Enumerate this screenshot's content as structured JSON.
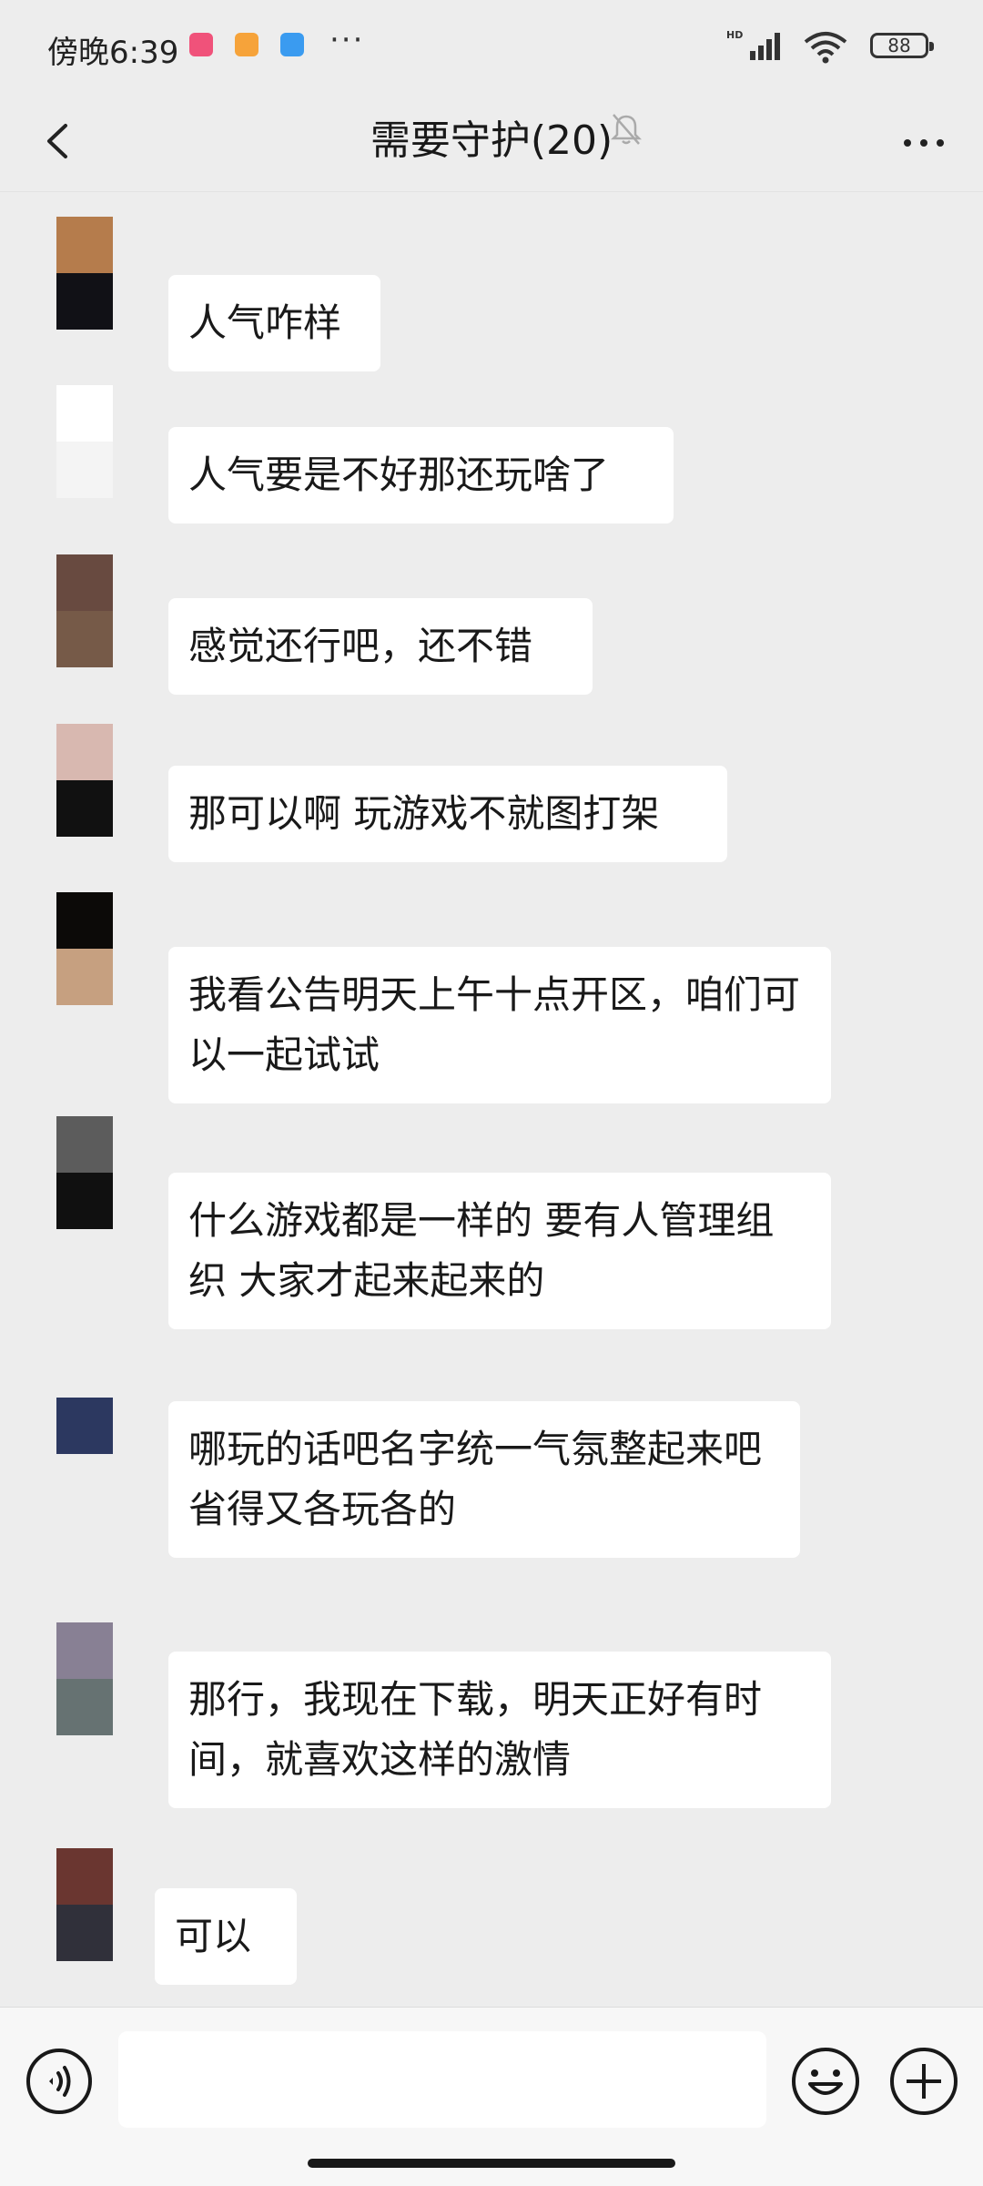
{
  "status_bar": {
    "time": "傍晚6:39",
    "more": "···",
    "network": "HD",
    "battery": "88"
  },
  "nav": {
    "title": "需要守护(20)"
  },
  "messages": [
    {
      "text": "人气咋样",
      "avatar_colors": [
        "#b57c4c",
        "#111116"
      ]
    },
    {
      "text": "人气要是不好那还玩啥了",
      "avatar_colors": [
        "#ffffff",
        "#f4f4f4"
      ]
    },
    {
      "text": "感觉还行吧，还不错",
      "avatar_colors": [
        "#684a40",
        "#765a48"
      ]
    },
    {
      "text": "那可以啊 玩游戏不就图打架",
      "avatar_colors": [
        "#d8b8b0",
        "#111111"
      ]
    },
    {
      "text": "我看公告明天上午十点开区，咱们可以一起试试",
      "avatar_colors": [
        "#0c0a08",
        "#c6a080"
      ]
    },
    {
      "text": "什么游戏都是一样的 要有人管理组织 大家才起来起来的",
      "avatar_colors": [
        "#5c5c5c",
        "#101010"
      ]
    },
    {
      "text": "哪玩的话吧名字统一气氛整起来吧 省得又各玩各的",
      "avatar_colors": [
        "#2c3860"
      ]
    },
    {
      "text": "那行，我现在下载，明天正好有时间，就喜欢这样的激情",
      "avatar_colors": [
        "#888094",
        "#667272"
      ]
    },
    {
      "text": "可以",
      "avatar_colors": [
        "#6a3630",
        "#30303a"
      ]
    }
  ],
  "input": {
    "placeholder": ""
  }
}
